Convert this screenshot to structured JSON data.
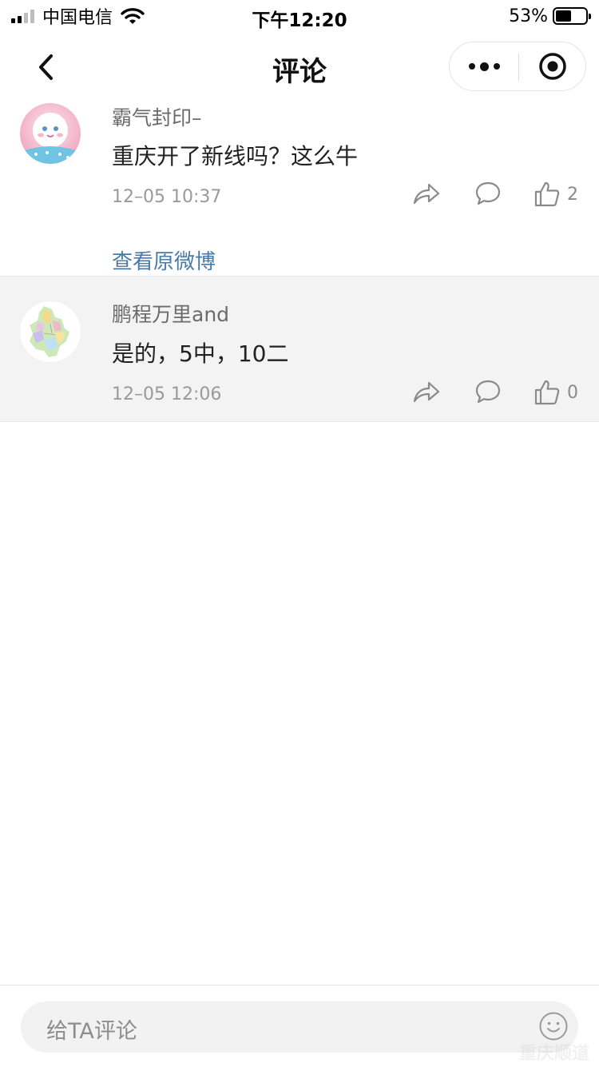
{
  "status_bar": {
    "carrier": "中国电信",
    "time": "下午12:20",
    "battery_percent_label": "53%",
    "battery_level": 0.53
  },
  "nav": {
    "title": "评论"
  },
  "comments": [
    {
      "username": "霸气封印–",
      "content": "重庆开了新线吗？这么牛",
      "time": "12–05 10:37",
      "likes": "2",
      "link": "查看原微博"
    },
    {
      "username": "鹏程万里and",
      "content": "是的，5中，10二",
      "time": "12–05 12:06",
      "likes": "0"
    }
  ],
  "input": {
    "placeholder": "给TA评论"
  },
  "watermark": "重庆顺道"
}
